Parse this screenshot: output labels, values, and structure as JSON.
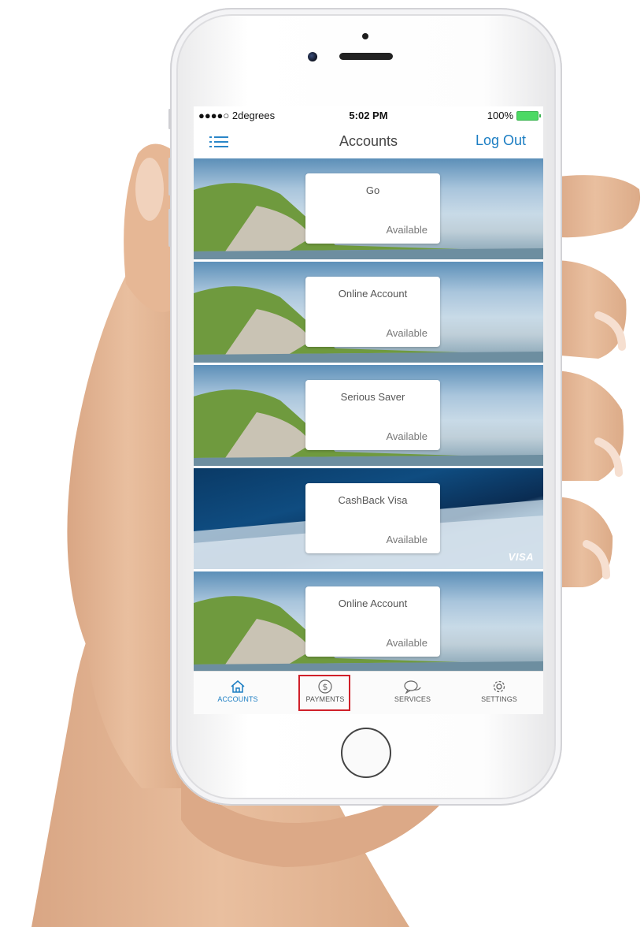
{
  "status_bar": {
    "carrier": "●●●●○ 2degrees",
    "time": "5:02 PM",
    "battery": "100%"
  },
  "navbar": {
    "menu_icon": "hamburger-menu-icon",
    "title": "Accounts",
    "logout_label": "Log Out"
  },
  "accounts": [
    {
      "name": "Go",
      "status": "Available",
      "background": "scenic"
    },
    {
      "name": "Online Account",
      "status": "Available",
      "background": "scenic"
    },
    {
      "name": "Serious Saver",
      "status": "Available",
      "background": "scenic"
    },
    {
      "name": "CashBack Visa",
      "status": "Available",
      "background": "visa",
      "brand": "VISA"
    },
    {
      "name": "Online Account",
      "status": "Available",
      "background": "scenic"
    }
  ],
  "tabbar": {
    "items": [
      {
        "label": "ACCOUNTS",
        "icon": "home-icon",
        "active": true
      },
      {
        "label": "PAYMENTS",
        "icon": "dollar-circle-icon",
        "active": false,
        "highlighted": true
      },
      {
        "label": "SERVICES",
        "icon": "chat-bubbles-icon",
        "active": false
      },
      {
        "label": "SETTINGS",
        "icon": "gear-icon",
        "active": false
      }
    ]
  },
  "colors": {
    "accent": "#1c7ec3",
    "highlight_box": "#d0202a",
    "battery": "#4cd964"
  }
}
